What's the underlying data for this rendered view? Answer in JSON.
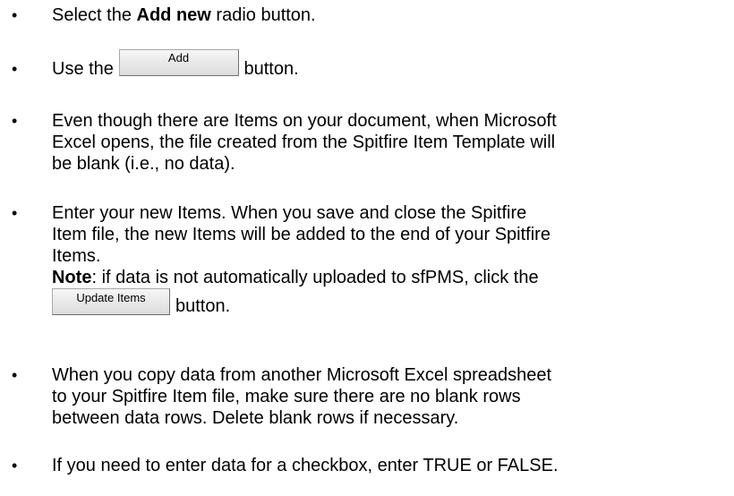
{
  "bullet_char": "•",
  "items": [
    {
      "pre": "Select the ",
      "bold": "Add new",
      "post": " radio button."
    },
    {
      "pre": "Use the",
      "button_label": "Add",
      "post": "button."
    },
    {
      "lines": [
        "Even though there are Items on your document, when Microsoft",
        "Excel opens, the file created from the Spitfire Item Template will",
        "be blank (i.e., no data)."
      ]
    },
    {
      "lines": [
        "Enter your new Items.  When you save and close the Spitfire",
        "Item file, the new Items will be added to the end of your Spitfire",
        "Items."
      ],
      "note_label": "Note",
      "note_text": ": if data is not automatically uploaded to sfPMS, click the",
      "button_label": "Update Items",
      "post": "button."
    },
    {
      "lines": [
        "When you copy data from another Microsoft Excel spreadsheet",
        "to your Spitfire Item file, make sure there are no blank rows",
        "between data rows.  Delete blank rows if necessary."
      ]
    },
    {
      "lines": [
        "If you need to enter data for a checkbox, enter TRUE or FALSE."
      ]
    }
  ]
}
